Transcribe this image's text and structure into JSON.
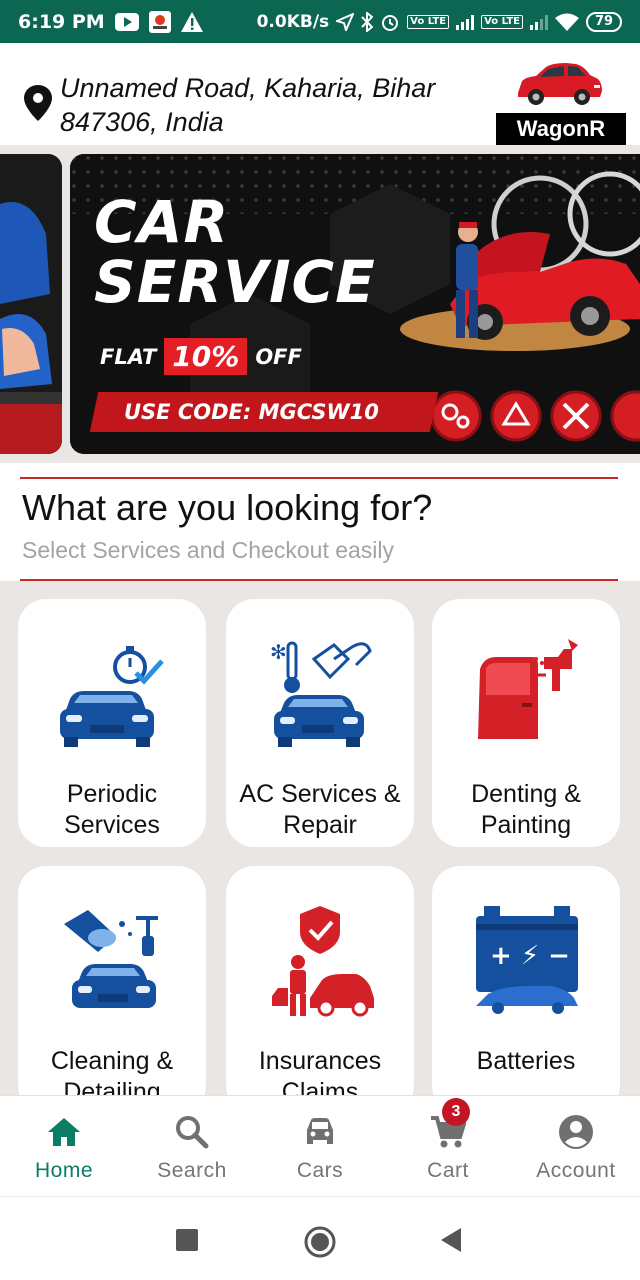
{
  "status_bar": {
    "time": "6:19 PM",
    "network_speed": "0.0KB/s",
    "lte_label": "Vo LTE",
    "battery": "79",
    "icons": [
      "youtube-icon",
      "app-icon",
      "warning-icon",
      "location-arrow-icon",
      "bluetooth-icon",
      "alarm-icon",
      "signal-icon",
      "wifi-icon",
      "battery-icon"
    ]
  },
  "header": {
    "address_line1": "Unnamed Road, Kaharia, Bihar",
    "address_line2": "847306, India",
    "car_model": "WagonR"
  },
  "banner": {
    "title_line1": "CAR",
    "title_line2": "SERVICE",
    "flat_label": "FLAT",
    "discount": "10%",
    "off_label": "OFF",
    "code_text": "USE CODE: MGCSW10"
  },
  "section": {
    "title": "What are you looking for?",
    "subtitle": "Select Services and Checkout easily"
  },
  "services": [
    {
      "label": "Periodic Services",
      "icon": "periodic-service-icon"
    },
    {
      "label": "AC Services & Repair",
      "icon": "ac-service-icon"
    },
    {
      "label": "Denting & Painting",
      "icon": "denting-painting-icon"
    },
    {
      "label": "Cleaning & Detailing",
      "icon": "cleaning-icon"
    },
    {
      "label": "Insurances Claims",
      "icon": "insurance-icon"
    },
    {
      "label": "Batteries",
      "icon": "battery-service-icon"
    }
  ],
  "bottom_nav": {
    "items": [
      {
        "label": "Home",
        "icon": "home-icon",
        "active": true
      },
      {
        "label": "Search",
        "icon": "search-icon",
        "active": false
      },
      {
        "label": "Cars",
        "icon": "car-icon",
        "active": false
      },
      {
        "label": "Cart",
        "icon": "cart-icon",
        "active": false
      },
      {
        "label": "Account",
        "icon": "account-icon",
        "active": false
      }
    ],
    "cart_count": "3"
  },
  "colors": {
    "status_bar": "#0b6652",
    "accent_green": "#0b7d66",
    "brand_red": "#e31e24",
    "icon_blue": "#15509e",
    "grid_background": "#e9e6e4"
  }
}
